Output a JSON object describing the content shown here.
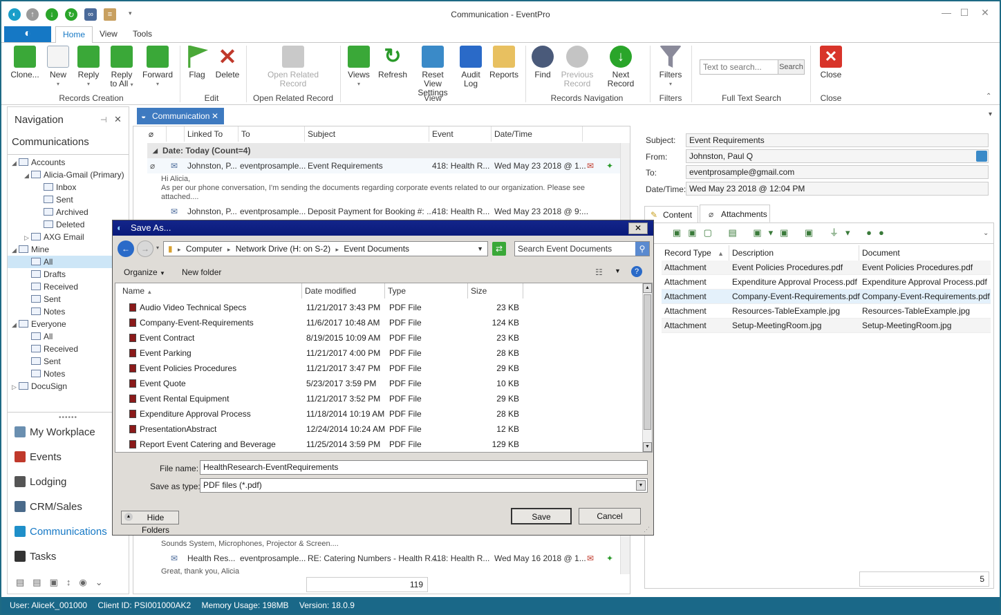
{
  "window": {
    "title": "Communication - EventPro"
  },
  "ribbon_tabs": [
    {
      "label": "Home"
    },
    {
      "label": "View"
    },
    {
      "label": "Tools"
    }
  ],
  "ribbon": {
    "clone": "Clone...",
    "new": "New",
    "reply": "Reply",
    "reply_all_1": "Reply",
    "reply_all_2": "to All",
    "forward": "Forward",
    "flag": "Flag",
    "delete": "Delete",
    "open_related_1": "Open Related",
    "open_related_2": "Record",
    "views": "Views",
    "refresh": "Refresh",
    "reset_view_1": "Reset View",
    "reset_view_2": "Settings",
    "audit_1": "Audit",
    "audit_2": "Log",
    "reports": "Reports",
    "find": "Find",
    "previous_1": "Previous",
    "previous_2": "Record",
    "next_record": "Next Record",
    "filters": "Filters",
    "search_placeholder": "Text to search...",
    "search_button": "Search",
    "close": "Close",
    "groups": {
      "records_creation": "Records Creation",
      "edit": "Edit",
      "open_related_record": "Open Related Record",
      "view": "View",
      "records_navigation": "Records Navigation",
      "filters": "Filters",
      "full_text_search": "Full Text Search",
      "close": "Close"
    }
  },
  "navigation": {
    "title": "Navigation",
    "subtitle": "Communications",
    "tree": [
      {
        "label": "Accounts",
        "indent": 0,
        "toggle": "◢"
      },
      {
        "label": "Alicia-Gmail (Primary)",
        "indent": 1,
        "toggle": "◢"
      },
      {
        "label": "Inbox",
        "indent": 2,
        "toggle": ""
      },
      {
        "label": "Sent",
        "indent": 2,
        "toggle": ""
      },
      {
        "label": "Archived",
        "indent": 2,
        "toggle": ""
      },
      {
        "label": "Deleted",
        "indent": 2,
        "toggle": ""
      },
      {
        "label": "AXG Email",
        "indent": 1,
        "toggle": "▷"
      },
      {
        "label": "Mine",
        "indent": 0,
        "toggle": "◢"
      },
      {
        "label": "All",
        "indent": 1,
        "toggle": "",
        "selected": true
      },
      {
        "label": "Drafts",
        "indent": 1,
        "toggle": ""
      },
      {
        "label": "Received",
        "indent": 1,
        "toggle": ""
      },
      {
        "label": "Sent",
        "indent": 1,
        "toggle": ""
      },
      {
        "label": "Notes",
        "indent": 1,
        "toggle": ""
      },
      {
        "label": "Everyone",
        "indent": 0,
        "toggle": "◢"
      },
      {
        "label": "All",
        "indent": 1,
        "toggle": ""
      },
      {
        "label": "Received",
        "indent": 1,
        "toggle": ""
      },
      {
        "label": "Sent",
        "indent": 1,
        "toggle": ""
      },
      {
        "label": "Notes",
        "indent": 1,
        "toggle": ""
      },
      {
        "label": "DocuSign",
        "indent": 0,
        "toggle": "▷"
      }
    ],
    "modules": [
      {
        "label": "My Workplace",
        "color": "#6a8fb0"
      },
      {
        "label": "Events",
        "color": "#c0392b"
      },
      {
        "label": "Lodging",
        "color": "#555555"
      },
      {
        "label": "CRM/Sales",
        "color": "#4a6a8a"
      },
      {
        "label": "Communications",
        "color": "#1f8fc9",
        "active": true
      },
      {
        "label": "Tasks",
        "color": "#333333"
      }
    ]
  },
  "document_tab": {
    "label": "Communication"
  },
  "grid": {
    "columns": [
      "Linked To",
      "To",
      "Subject",
      "Event",
      "Date/Time"
    ],
    "group_header": "Date: Today (Count=4)",
    "rows": [
      {
        "linked": "Johnston, P...",
        "to": "eventprosample...",
        "subject": "Event Requirements",
        "event": "418: Health R...",
        "date": "Wed May 23 2018 @ 1..."
      },
      {
        "linked": "Johnston, P...",
        "to": "eventprosample...",
        "subject": "Deposit Payment for Booking #: ...",
        "event": "418: Health R...",
        "date": "Wed May 23 2018 @ 9:..."
      },
      {
        "linked": "Health Res...",
        "to": "eventprosample...",
        "subject": "RE: Catering Numbers - Health R...",
        "event": "418: Health R...",
        "date": "Wed May 16 2018 @ 1..."
      }
    ],
    "preview_line1": "Hi Alicia,",
    "preview_line2": "As per our phone conversation, I'm sending the documents regarding corporate events related to our organization.  Please see",
    "preview_line3": "attached....",
    "preview_line4": "Sounds System, Microphones, Projector & Screen....",
    "preview_line5": "Great, thank you, Alicia",
    "footer_count": "119"
  },
  "detail": {
    "subject_label": "Subject:",
    "subject": "Event Requirements",
    "from_label": "From:",
    "from": "Johnston, Paul Q",
    "to_label": "To:",
    "to": "eventprosample@gmail.com",
    "date_label": "Date/Time:",
    "date": "Wed May 23 2018 @ 12:04 PM",
    "tab_content": "Content",
    "tab_attachments": "Attachments",
    "att_columns": [
      "Record Type",
      "Description",
      "Document"
    ],
    "attachments": [
      {
        "type": "Attachment",
        "description": "Event Policies Procedures.pdf",
        "document": "Event Policies Procedures.pdf"
      },
      {
        "type": "Attachment",
        "description": "Expenditure Approval Process.pdf",
        "document": "Expenditure Approval Process.pdf"
      },
      {
        "type": "Attachment",
        "description": "Company-Event-Requirements.pdf",
        "document": "Company-Event-Requirements.pdf"
      },
      {
        "type": "Attachment",
        "description": "Resources-TableExample.jpg",
        "document": "Resources-TableExample.jpg"
      },
      {
        "type": "Attachment",
        "description": "Setup-MeetingRoom.jpg",
        "document": "Setup-MeetingRoom.jpg"
      }
    ],
    "footer_count": "5"
  },
  "dialog": {
    "title": "Save As...",
    "breadcrumb": [
      "Computer",
      "Network Drive (H: on S-2)",
      "Event Documents"
    ],
    "search_placeholder": "Search Event Documents",
    "organize": "Organize",
    "new_folder": "New folder",
    "columns": [
      "Name",
      "Date modified",
      "Type",
      "Size"
    ],
    "files": [
      {
        "name": "Audio Video Technical Specs",
        "date": "11/21/2017 3:43 PM",
        "type": "PDF File",
        "size": "23 KB"
      },
      {
        "name": "Company-Event-Requirements",
        "date": "11/6/2017 10:48 AM",
        "type": "PDF File",
        "size": "124 KB"
      },
      {
        "name": "Event Contract",
        "date": "8/19/2015 10:09 AM",
        "type": "PDF File",
        "size": "23 KB"
      },
      {
        "name": "Event Parking",
        "date": "11/21/2017 4:00 PM",
        "type": "PDF File",
        "size": "28 KB"
      },
      {
        "name": "Event Policies Procedures",
        "date": "11/21/2017 3:47 PM",
        "type": "PDF File",
        "size": "29 KB"
      },
      {
        "name": "Event Quote",
        "date": "5/23/2017 3:59 PM",
        "type": "PDF File",
        "size": "10 KB"
      },
      {
        "name": "Event Rental Equipment",
        "date": "11/21/2017 3:52 PM",
        "type": "PDF File",
        "size": "29 KB"
      },
      {
        "name": "Expenditure Approval Process",
        "date": "11/18/2014 10:19 AM",
        "type": "PDF File",
        "size": "28 KB"
      },
      {
        "name": "PresentationAbstract",
        "date": "12/24/2014 10:24 AM",
        "type": "PDF File",
        "size": "12 KB"
      },
      {
        "name": "Report Event Catering and Beverage",
        "date": "11/25/2014 3:59 PM",
        "type": "PDF File",
        "size": "129 KB"
      }
    ],
    "file_name_label": "File name:",
    "file_name": "HealthResearch-EventRequirements",
    "save_type_label": "Save as type:",
    "save_type": "PDF files (*.pdf)",
    "hide_folders": "Hide Folders",
    "save": "Save",
    "cancel": "Cancel"
  },
  "status": {
    "user": "User: AliceK_001000",
    "client": "Client ID: PSI001000AK2",
    "memory": "Memory Usage: 198MB",
    "version": "Version: 18.0.9"
  }
}
